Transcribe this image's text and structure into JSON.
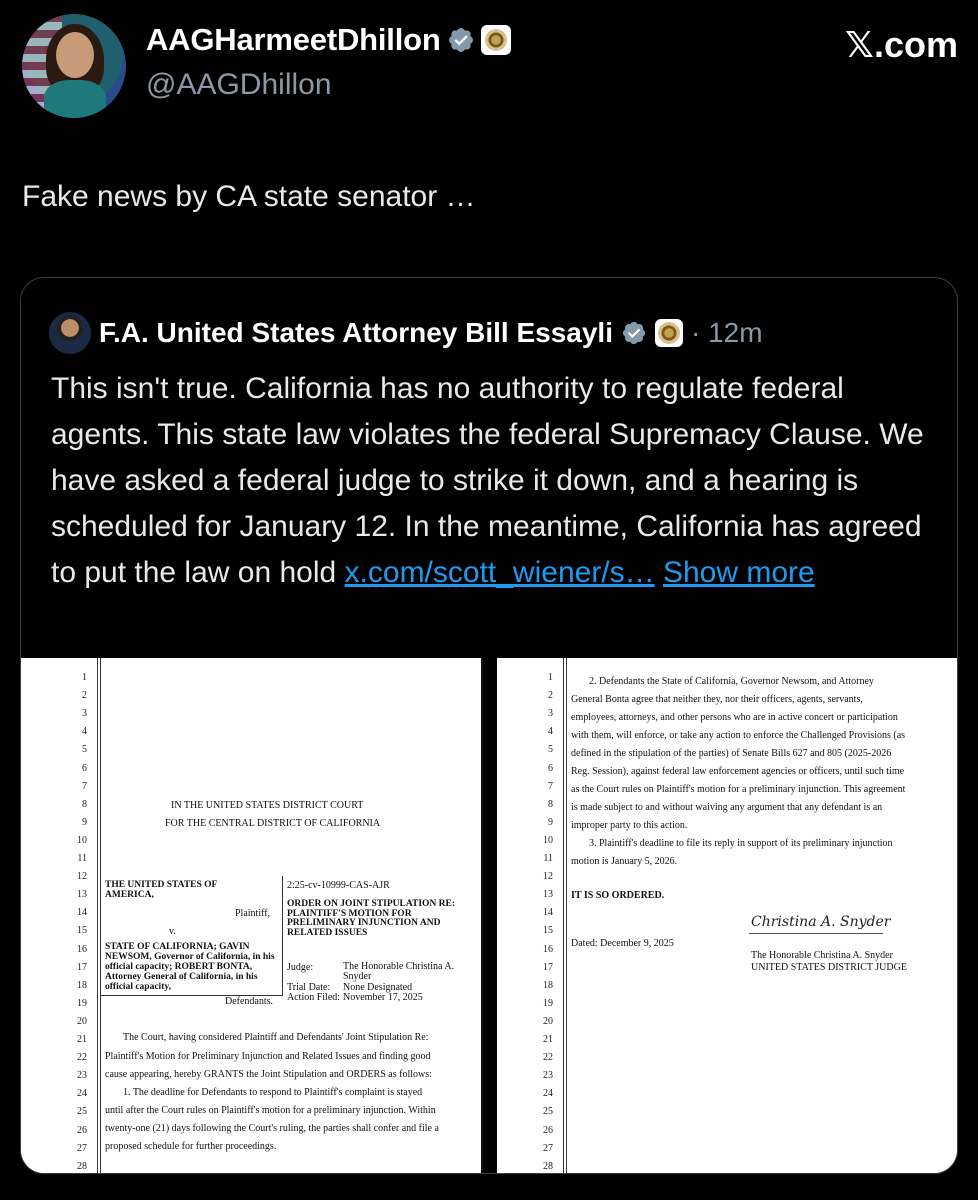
{
  "header": {
    "display_name": "AAGHarmeetDhillon",
    "handle": "@AAGDhillon",
    "site": "𝕏.com",
    "icons": [
      "verified-badge-icon",
      "government-seal-icon"
    ]
  },
  "tweet": {
    "text": "Fake news by CA state senator …"
  },
  "quote": {
    "name": "F.A. United States Attorney Bill Essayli",
    "time": "· 12m",
    "text_before_link": "This isn't true. California has no authority to regulate federal agents. This state law violates the federal Supremacy Clause. We have asked a federal judge to strike it down, and a hearing is scheduled for January 12. In the meantime, California has agreed to put the law on hold ",
    "link": "x.com/scott_wiener/s…",
    "show_more": "Show more"
  },
  "document_left": {
    "line_numbers": [
      "1",
      "2",
      "3",
      "4",
      "5",
      "6",
      "7",
      "8",
      "9",
      "10",
      "11",
      "12",
      "13",
      "14",
      "15",
      "16",
      "17",
      "18",
      "19",
      "20",
      "21",
      "22",
      "23",
      "24",
      "25",
      "26",
      "27",
      "28"
    ],
    "court_line1": "IN THE UNITED STATES DISTRICT COURT",
    "court_line2": "FOR THE CENTRAL DISTRICT OF CALIFORNIA",
    "plaintiff_name": "THE UNITED STATES OF AMERICA,",
    "plaintiff_role": "Plaintiff,",
    "versus": "v.",
    "defendants_name": "STATE OF CALIFORNIA; GAVIN NEWSOM, Governor of California, in his official capacity; ROBERT BONTA, Attorney General of California, in his official capacity,",
    "defendants_role": "Defendants.",
    "case_no": "2:25-cv-10999-CAS-AJR",
    "order_title": "ORDER ON JOINT STIPULATION RE: PLAINTIFF'S MOTION FOR PRELIMINARY INJUNCTION AND RELATED ISSUES",
    "judge_label": "Judge:",
    "judge_value": "The Honorable Christina A. Snyder",
    "trial_label": "Trial Date:",
    "trial_value": "None Designated",
    "filed_label": "Action Filed:",
    "filed_value": "November 17, 2025",
    "body_21": "The Court, having considered Plaintiff and Defendants' Joint Stipulation Re:",
    "body_22": "Plaintiff's Motion for Preliminary Injunction and Related Issues and finding good",
    "body_23": "cause appearing, hereby GRANTS the Joint Stipulation and ORDERS as follows:",
    "body_24": "1.     The deadline for Defendants to respond to Plaintiff's complaint is stayed",
    "body_25": "until after the Court rules on Plaintiff's motion for a preliminary injunction.  Within",
    "body_26": "twenty-one (21) days following the Court's ruling, the parties shall confer and file a",
    "body_27": "proposed schedule for further proceedings."
  },
  "document_right": {
    "line_numbers": [
      "1",
      "2",
      "3",
      "4",
      "5",
      "6",
      "7",
      "8",
      "9",
      "10",
      "11",
      "12",
      "13",
      "14",
      "15",
      "16",
      "17",
      "18",
      "19",
      "20",
      "21",
      "22",
      "23",
      "24",
      "25",
      "26",
      "27",
      "28"
    ],
    "l1": "2.     Defendants the State of California, Governor Newsom, and Attorney",
    "l2": "General Bonta agree that neither they, nor their officers, agents, servants,",
    "l3": "employees, attorneys, and other persons who are in active concert or participation",
    "l4": "with them, will enforce, or take any action to enforce the Challenged Provisions (as",
    "l5": "defined in the stipulation of the parties) of Senate Bills 627 and 805 (2025-2026",
    "l6": "Reg. Session), against federal law enforcement agencies or officers, until such time",
    "l7": "as the Court rules on Plaintiff's motion for a preliminary injunction. This agreement",
    "l8": "is made subject to and without waiving any argument that any defendant is an",
    "l9": "improper party to this action.",
    "l10": "3.     Plaintiff's deadline to file its reply in support of its preliminary injunction",
    "l11": "motion is January 5, 2026.",
    "ordered": "IT IS SO ORDERED.",
    "signature": "Christina A. Snyder",
    "dated": "Dated: December 9, 2025",
    "judge_name": "The Honorable Christina A. Snyder",
    "judge_title": "UNITED STATES DISTRICT JUDGE"
  }
}
